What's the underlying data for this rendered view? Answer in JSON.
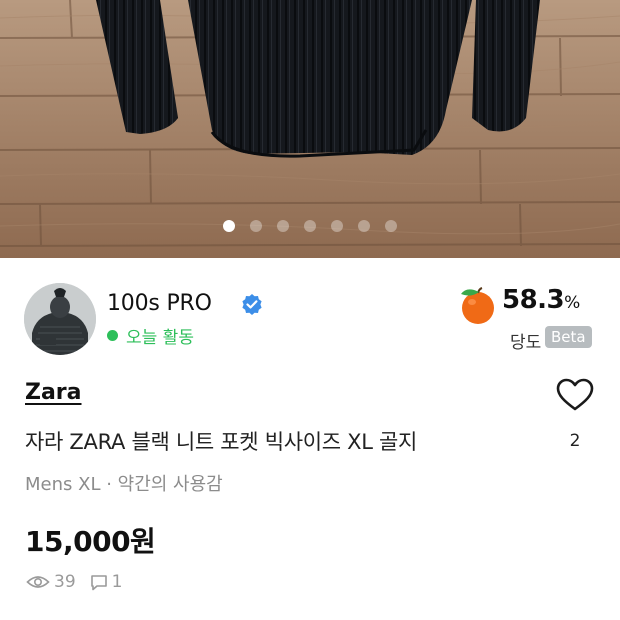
{
  "carousel": {
    "total": 7,
    "active_index": 0
  },
  "seller": {
    "name": "100s PRO",
    "verified_icon": "verified-badge-icon",
    "activity": "오늘 활동",
    "activity_color": "#2dbf5a"
  },
  "sweetness": {
    "icon": "orange-fruit-icon",
    "value": "58.3",
    "unit": "%",
    "label": "당도",
    "badge": "Beta"
  },
  "product": {
    "brand": "Zara",
    "title": "자라 ZARA 블랙 니트 포켓 빅사이즈 XL 골지",
    "meta": "Mens XL · 약간의 사용감",
    "price": "15,000원"
  },
  "like": {
    "icon": "heart-icon",
    "count": "2"
  },
  "stats": {
    "views_icon": "eye-icon",
    "views": "39",
    "comments_icon": "chat-bubble-icon",
    "comments": "1"
  }
}
